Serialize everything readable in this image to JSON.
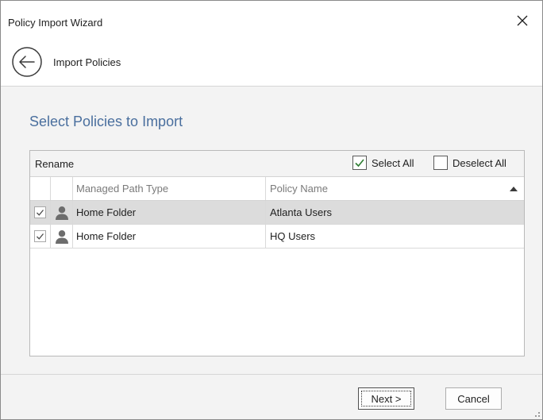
{
  "window": {
    "title": "Policy Import Wizard"
  },
  "nav": {
    "title": "Import Policies"
  },
  "section": {
    "title": "Select Policies to Import"
  },
  "grid": {
    "toolbar": {
      "rename_label": "Rename",
      "select_all_label": "Select All",
      "select_all_checked": true,
      "deselect_all_label": "Deselect All",
      "deselect_all_checked": false
    },
    "columns": [
      "Managed Path Type",
      "Policy Name"
    ],
    "sort": {
      "column": "Policy Name",
      "direction": "ascending"
    },
    "rows": [
      {
        "checked": true,
        "icon": "user-icon",
        "managed_path_type": "Home Folder",
        "policy_name": "Atlanta Users",
        "selected": true
      },
      {
        "checked": true,
        "icon": "user-icon",
        "managed_path_type": "Home Folder",
        "policy_name": "HQ Users",
        "selected": false
      }
    ]
  },
  "footer": {
    "next_label": "Next >",
    "cancel_label": "Cancel"
  },
  "colors": {
    "section_title": "#4a6f9e",
    "checkmark": "#2e7d32",
    "selected_row": "#dcdcdc"
  }
}
